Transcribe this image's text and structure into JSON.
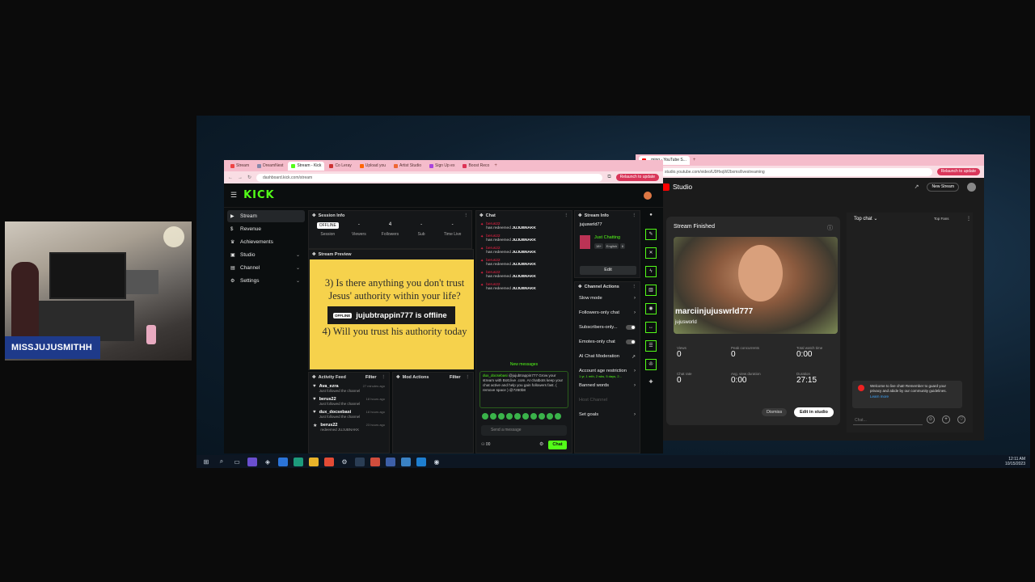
{
  "stream_overlay": {
    "cam_name": "MISSJUJUSMITHH"
  },
  "kick_browser": {
    "tabs": [
      "Stream",
      "DreamNest",
      "Stream - Kick",
      "Co Leray",
      "Upload you",
      "Artist Studio",
      "Sign Up ex",
      "Boost Reco"
    ],
    "active_tab": 2,
    "url": "dashboard.kick.com/stream",
    "update_label": "Relaunch to update",
    "logo": "KICK",
    "sidebar": [
      {
        "icon": "▶",
        "label": "Stream",
        "active": true
      },
      {
        "icon": "$",
        "label": "Revenue"
      },
      {
        "icon": "🏆",
        "label": "Achievements"
      },
      {
        "icon": "▣",
        "label": "Studio",
        "chevron": true
      },
      {
        "icon": "▤",
        "label": "Channel",
        "chevron": true
      },
      {
        "icon": "⚙",
        "label": "Settings",
        "chevron": true
      }
    ],
    "session_info": {
      "title": "Session Info",
      "badge": "OFFLINE",
      "stats": [
        {
          "value": "",
          "label": "Session"
        },
        {
          "value": "-",
          "label": "Viewers"
        },
        {
          "value": "4",
          "label": "Followers"
        },
        {
          "value": "-",
          "label": "Sub"
        },
        {
          "value": "-",
          "label": "Time Live"
        }
      ]
    },
    "stream_preview": {
      "title": "Stream Preview",
      "line1": "3) Is there anything you don't trust",
      "line2": "Jesus' authority within your life?",
      "line3": "4) Will you trust his authority today",
      "offline_badge": "OFFLINE",
      "offline_text": "jujubtrappin777 is offline"
    },
    "activity_feed": {
      "title": "Activity Feed",
      "filter": "Filter",
      "items": [
        {
          "name": "Ava_ezra",
          "time": "27 minutes ago",
          "desc": "Just followed the channel"
        },
        {
          "name": "berus22",
          "time": "18 hours ago",
          "desc": "Just followed the channel"
        },
        {
          "name": "dux_docsebasi",
          "time": "18 hours ago",
          "desc": "Just followed the channel"
        },
        {
          "name": "berus22",
          "time": "23 hours ago",
          "desc": "redeemed JUJUBNAKK"
        }
      ]
    },
    "mod_actions": {
      "title": "Mod Actions",
      "filter": "Filter"
    },
    "chat": {
      "title": "Chat",
      "messages": [
        {
          "user": "berus22",
          "text": "has redeemed",
          "reward": "JUJUBNAKK"
        },
        {
          "user": "berus22",
          "text": "has redeemed",
          "reward": "JUJUBNAKK"
        },
        {
          "user": "berus22",
          "text": "has redeemed",
          "reward": "JUJUBNAKK"
        },
        {
          "user": "berus22",
          "text": "has redeemed",
          "reward": "JUJUBNAKK"
        },
        {
          "user": "berus22",
          "text": "has redeemed",
          "reward": "JUJUBNAKK"
        },
        {
          "user": "berus22",
          "text": "has redeemed",
          "reward": "JUJUBNAKK"
        }
      ],
      "new_messages": "New messages",
      "bot_user": "dux_docsebasi",
      "bot_text": "@jujubtrappin777 Grow your stream with Bott.live .com. AI chatbots keep your chat active and help you gain followers fast. ( remove space ) @7260b8",
      "input_placeholder": "Send a message",
      "count": "00",
      "send": "Chat"
    },
    "stream_info": {
      "title": "Stream Info",
      "username": "jujuswrld77",
      "category": "Just Chatting",
      "tags": [
        "18+",
        "English",
        "6"
      ],
      "edit": "Edit"
    },
    "channel_actions": {
      "title": "Channel Actions",
      "items": [
        {
          "label": "Slow mode",
          "kind": "arrow"
        },
        {
          "label": "Followers-only chat",
          "kind": "arrow"
        },
        {
          "label": "Subscribers-only...",
          "kind": "toggle"
        },
        {
          "label": "Emotes-only chat",
          "kind": "toggle"
        },
        {
          "label": "AI Chat Moderation",
          "kind": "ext"
        },
        {
          "label": "Account age restriction",
          "kind": "arrow",
          "sub": "1 yr, 1 mth, 2 wks, 5 days, 2..."
        },
        {
          "label": "Banned words",
          "kind": "arrow"
        },
        {
          "label": "Host Channel",
          "kind": "none",
          "dim": true
        },
        {
          "label": "Set goals",
          "kind": "arrow"
        }
      ]
    }
  },
  "youtube_studio": {
    "tab_title": "...ming - YouTube S...",
    "url": "studio.youtube.com/video/U9HxqW2bxms/livestreaming",
    "update_label": "Relaunch to update",
    "logo_text": "Studio",
    "new_stream": "New Stream",
    "card": {
      "title": "Stream Finished",
      "name": "marciinjujuswrld777",
      "handle": "jujusworld",
      "stats": [
        {
          "label": "Views",
          "value": "0"
        },
        {
          "label": "Peak concurrents",
          "value": "0"
        },
        {
          "label": "Total watch time",
          "value": "0:00"
        },
        {
          "label": "Chat rate",
          "value": "0"
        },
        {
          "label": "Avg. view duration",
          "value": "0:00"
        },
        {
          "label": "Duration",
          "value": "27:15"
        }
      ],
      "dismiss": "Dismiss",
      "edit_in_studio": "Edit in studio"
    },
    "chat": {
      "title": "Top chat",
      "top_fans": "Top Fans",
      "welcome": "Welcome to live chat! Remember to guard your privacy and abide by our community guidelines.",
      "learn_more": "Learn more",
      "input": "Chat..."
    }
  },
  "taskbar": {
    "time": "12:11 AM",
    "date": "10/15/2023"
  }
}
